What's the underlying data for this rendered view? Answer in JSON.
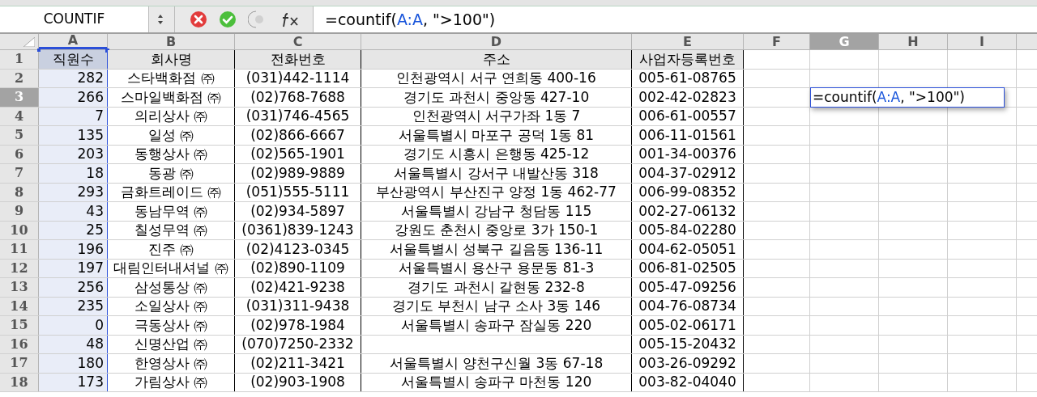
{
  "formula_bar": {
    "name_box": "COUNTIF",
    "formula": [
      {
        "kind": "text",
        "text": "=countif("
      },
      {
        "kind": "ref",
        "text": "A:A"
      },
      {
        "kind": "text",
        "text": ", \">100\")"
      }
    ]
  },
  "columns": [
    {
      "label": "A",
      "selected": false,
      "referenced": true
    },
    {
      "label": "B",
      "selected": false,
      "referenced": false
    },
    {
      "label": "C",
      "selected": false,
      "referenced": false
    },
    {
      "label": "D",
      "selected": false,
      "referenced": false
    },
    {
      "label": "E",
      "selected": false,
      "referenced": false
    },
    {
      "label": "F",
      "selected": false,
      "referenced": false
    },
    {
      "label": "G",
      "selected": true,
      "referenced": false
    },
    {
      "label": "H",
      "selected": false,
      "referenced": false
    },
    {
      "label": "I",
      "selected": false,
      "referenced": false
    }
  ],
  "rows": [
    {
      "label": "1",
      "kind": "header",
      "selected": false,
      "cells": [
        "직원수",
        "회사명",
        "전화번호",
        "주소",
        "사업자등록번호"
      ]
    },
    {
      "label": "2",
      "kind": "data",
      "selected": false,
      "cells": [
        "282",
        "스타백화점 ㈜",
        "(031)442-1114",
        "인천광역시 서구 연희동 400-16",
        "005-61-08765"
      ]
    },
    {
      "label": "3",
      "kind": "data",
      "selected": true,
      "cells": [
        "266",
        "스마일백화점 ㈜",
        "(02)768-7688",
        "경기도 과천시 중앙동 427-10",
        "002-42-02823"
      ],
      "editor": [
        {
          "kind": "text",
          "text": "=countif("
        },
        {
          "kind": "ref",
          "text": "A:A"
        },
        {
          "kind": "text",
          "text": ", \">100\")"
        }
      ]
    },
    {
      "label": "4",
      "kind": "data",
      "selected": false,
      "cells": [
        "7",
        "의리상사 ㈜",
        "(031)746-4565",
        "인천광역시 서구가좌 1동 7",
        "006-61-00557"
      ]
    },
    {
      "label": "5",
      "kind": "data",
      "selected": false,
      "cells": [
        "135",
        "일성 ㈜",
        "(02)866-6667",
        "서울특별시 마포구 공덕 1동 81",
        "006-11-01561"
      ]
    },
    {
      "label": "6",
      "kind": "data",
      "selected": false,
      "cells": [
        "203",
        "동행상사 ㈜",
        "(02)565-1901",
        "경기도 시흥시 은행동 425-12",
        "001-34-00376"
      ]
    },
    {
      "label": "7",
      "kind": "data",
      "selected": false,
      "cells": [
        "18",
        "동광 ㈜",
        "(02)989-9889",
        "서울특별시 강서구 내발산동 318",
        "004-37-02912"
      ]
    },
    {
      "label": "8",
      "kind": "data",
      "selected": false,
      "cells": [
        "293",
        "금화트레이드 ㈜",
        "(051)555-5111",
        "부산광역시 부산진구 양정 1동 462-77",
        "006-99-08352"
      ]
    },
    {
      "label": "9",
      "kind": "data",
      "selected": false,
      "cells": [
        "43",
        "동남무역 ㈜",
        "(02)934-5897",
        "서울특별시 강남구 청담동 115",
        "002-27-06132"
      ]
    },
    {
      "label": "10",
      "kind": "data",
      "selected": false,
      "cells": [
        "25",
        "칠성무역 ㈜",
        "(0361)839-1243",
        "강원도 춘천시 중앙로 3가 150-1",
        "005-84-02280"
      ]
    },
    {
      "label": "11",
      "kind": "data",
      "selected": false,
      "cells": [
        "196",
        "진주 ㈜",
        "(02)4123-0345",
        "서울특별시 성북구 길음동 136-11",
        "004-62-05051"
      ]
    },
    {
      "label": "12",
      "kind": "data",
      "selected": false,
      "cells": [
        "197",
        "대림인터내셔널 ㈜",
        "(02)890-1109",
        "서울특별시 용산구 용문동 81-3",
        "006-81-02505"
      ]
    },
    {
      "label": "13",
      "kind": "data",
      "selected": false,
      "cells": [
        "256",
        "삼성통상 ㈜",
        "(02)421-9238",
        "경기도 과천시 갈현동 232-8",
        "005-47-09256"
      ]
    },
    {
      "label": "14",
      "kind": "data",
      "selected": false,
      "cells": [
        "235",
        "소일상사 ㈜",
        "(031)311-9438",
        "경기도 부천시 남구 소사 3동 146",
        "004-76-08734"
      ]
    },
    {
      "label": "15",
      "kind": "data",
      "selected": false,
      "cells": [
        "0",
        "극동상사 ㈜",
        "(02)978-1984",
        "서울특별시 송파구 잠실동 220",
        "005-02-06171"
      ]
    },
    {
      "label": "16",
      "kind": "data",
      "selected": false,
      "cells": [
        "48",
        "신명산업 ㈜",
        "(070)7250-2332",
        null,
        "005-15-20432"
      ]
    },
    {
      "label": "17",
      "kind": "data",
      "selected": false,
      "cells": [
        "180",
        "한영상사 ㈜",
        "(02)211-3421",
        "서울특별시 양천구신월 3동 67-18",
        "003-26-09292"
      ]
    },
    {
      "label": "18",
      "kind": "data",
      "selected": false,
      "cells": [
        "173",
        "가림상사 ㈜",
        "(02)903-1908",
        "서울특별시 송파구 마천동 120",
        "003-82-04040"
      ]
    }
  ]
}
